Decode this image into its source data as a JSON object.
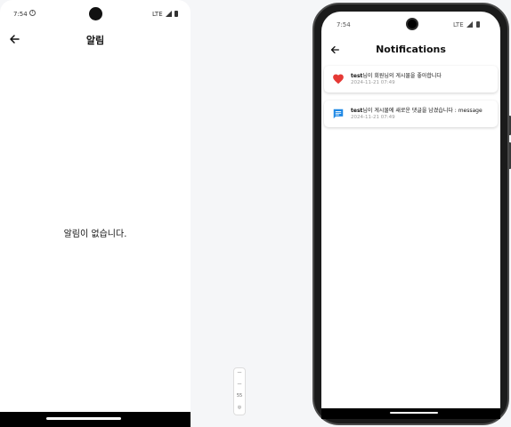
{
  "left_phone": {
    "status": {
      "time": "7:54",
      "network": "LTE"
    },
    "header": {
      "title": "알림"
    },
    "empty_message": "알림이 없습니다."
  },
  "mini_widget": {
    "items": [
      "—",
      "—",
      "55",
      "◎"
    ]
  },
  "right_phone": {
    "status": {
      "time": "7:54",
      "network": "LTE"
    },
    "header": {
      "title": "Notifications"
    },
    "notifications": [
      {
        "icon": "heart-icon",
        "color": "#e53935",
        "user": "test",
        "text": "님이 회원님의 게시물을 좋아합니다",
        "timestamp": "2024-11-21 07:49"
      },
      {
        "icon": "chat-icon",
        "color": "#1e88e5",
        "user": "test",
        "text": "님이 게시물에 새로운 댓글을 남겼습니다 : message",
        "timestamp": "2024-11-21 07:49"
      }
    ]
  }
}
